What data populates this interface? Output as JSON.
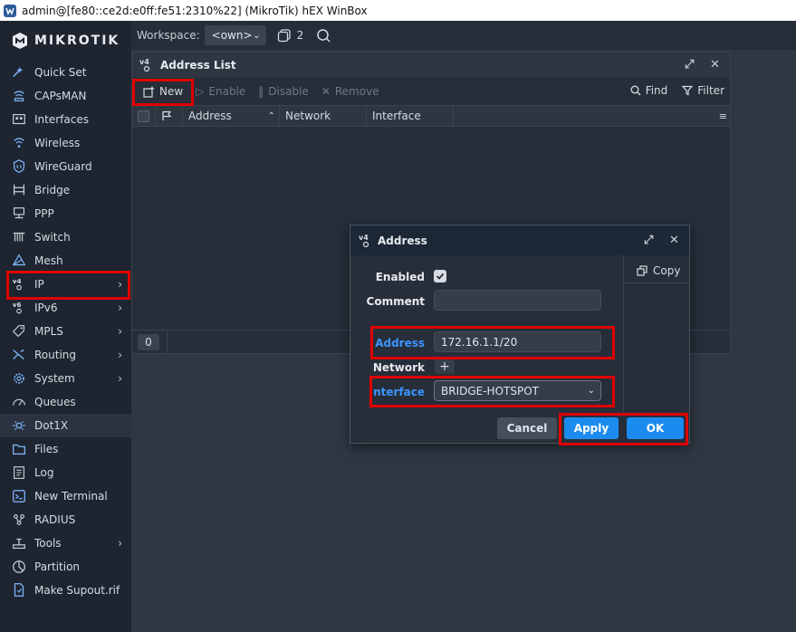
{
  "os_window": {
    "title": "admin@[fe80::ce2d:e0ff:fe51:2310%22] (MikroTik) hEX WinBox"
  },
  "brand": {
    "logo_text": "MIKROTIK"
  },
  "sidebar": {
    "items": [
      {
        "label": "Quick Set",
        "icon": "quick-set-icon",
        "chevron": false
      },
      {
        "label": "CAPsMAN",
        "icon": "capsman-icon",
        "chevron": false
      },
      {
        "label": "Interfaces",
        "icon": "interfaces-icon",
        "chevron": false
      },
      {
        "label": "Wireless",
        "icon": "wireless-icon",
        "chevron": false
      },
      {
        "label": "WireGuard",
        "icon": "wireguard-icon",
        "chevron": false
      },
      {
        "label": "Bridge",
        "icon": "bridge-icon",
        "chevron": false
      },
      {
        "label": "PPP",
        "icon": "ppp-icon",
        "chevron": false
      },
      {
        "label": "Switch",
        "icon": "switch-icon",
        "chevron": false
      },
      {
        "label": "Mesh",
        "icon": "mesh-icon",
        "chevron": false
      },
      {
        "label": "IP",
        "icon": "ip-v4-icon",
        "chevron": true
      },
      {
        "label": "IPv6",
        "icon": "ipv6-icon",
        "chevron": true
      },
      {
        "label": "MPLS",
        "icon": "mpls-icon",
        "chevron": true
      },
      {
        "label": "Routing",
        "icon": "routing-icon",
        "chevron": true
      },
      {
        "label": "System",
        "icon": "system-gear-icon",
        "chevron": true
      },
      {
        "label": "Queues",
        "icon": "queues-icon",
        "chevron": false
      },
      {
        "label": "Dot1X",
        "icon": "dot1x-icon",
        "chevron": false
      },
      {
        "label": "Files",
        "icon": "files-icon",
        "chevron": false
      },
      {
        "label": "Log",
        "icon": "log-icon",
        "chevron": false
      },
      {
        "label": "New Terminal",
        "icon": "terminal-icon",
        "chevron": false
      },
      {
        "label": "RADIUS",
        "icon": "radius-icon",
        "chevron": false
      },
      {
        "label": "Tools",
        "icon": "tools-icon",
        "chevron": true
      },
      {
        "label": "Partition",
        "icon": "partition-icon",
        "chevron": false
      },
      {
        "label": "Make Supout.rif",
        "icon": "supout-icon",
        "chevron": false
      }
    ]
  },
  "topbar": {
    "workspace_label": "Workspace:",
    "workspace_value": "<own>",
    "window_count": "2"
  },
  "address_list": {
    "title": "Address List",
    "toolbar": {
      "new": "New",
      "enable": "Enable",
      "disable": "Disable",
      "remove": "Remove",
      "find": "Find",
      "filter": "Filter"
    },
    "columns": [
      "Address",
      "Network",
      "Interface"
    ],
    "row_count": "0"
  },
  "address_dialog": {
    "title": "Address",
    "copy": "Copy",
    "enabled_label": "Enabled",
    "comment_label": "Comment",
    "comment_value": "",
    "address_label": "Address",
    "address_value": "172.16.1.1/20",
    "network_label": "Network",
    "network_add": "+",
    "interface_label": "Interface",
    "interface_value": "BRIDGE-HOTSPOT",
    "cancel": "Cancel",
    "apply": "Apply",
    "ok": "OK"
  },
  "colors": {
    "accent": "#1c8bf0",
    "highlight": "#e00000",
    "label_blue": "#3b94ff"
  }
}
